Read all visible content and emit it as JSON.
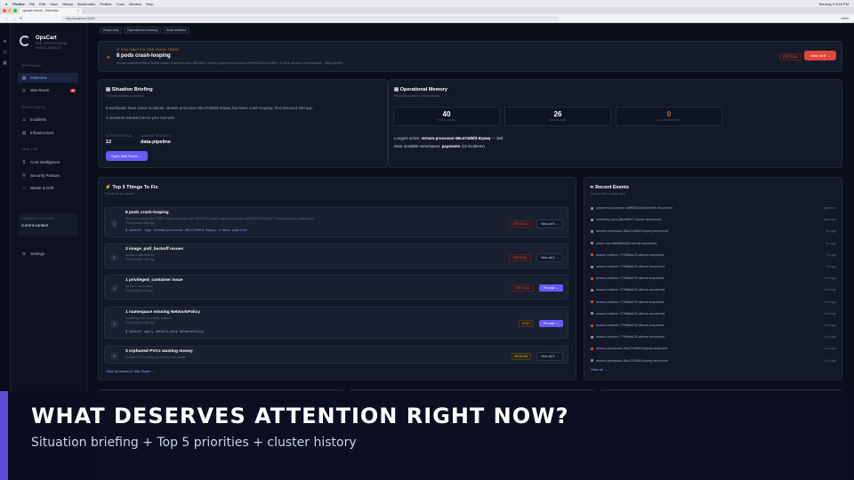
{
  "mac_menu": {
    "items": [
      "Firefox",
      "File",
      "Edit",
      "View",
      "History",
      "Bookmarks",
      "Profiles",
      "Tools",
      "Window",
      "Help"
    ],
    "clock": "Sat Aug 9 9:49 PM"
  },
  "browser": {
    "tab_title": "opscart review - Overview",
    "url": "http://localhost:3000/",
    "zoom": "100%"
  },
  "brand": {
    "name": "OpsCart",
    "sub": "K8S OPERATIONAL INTELLIGENCE"
  },
  "nav": {
    "sections": {
      "overview": "OVERVIEW",
      "investigate": "INVESTIGATE",
      "analyze": "ANALYZE"
    },
    "items": [
      {
        "label": "Overview",
        "icon": "grid-icon"
      },
      {
        "label": "War Room",
        "icon": "target-icon",
        "badge": "9"
      },
      {
        "label": "Incidents",
        "icon": "alert-icon"
      },
      {
        "label": "Infrastructure",
        "icon": "server-icon"
      },
      {
        "label": "Cost Intelligence",
        "icon": "dollar-icon"
      },
      {
        "label": "Security Posture",
        "icon": "shield-icon"
      },
      {
        "label": "Waste & Drift",
        "icon": "trash-icon"
      },
      {
        "label": "Settings",
        "icon": "gear-icon"
      }
    ],
    "cluster_label": "CURRENT CLUSTER",
    "cluster_value": "current-context"
  },
  "pills": [
    "Read-only",
    "Operational memory",
    "Auth enabled"
  ],
  "alert": {
    "kicker": "IF YOU ONLY FIX ONE THING TODAY",
    "title": "8 pods crash-looping",
    "desc": "stream-processor-66c474d5fd-9zpwq, inventory-sync-86cb8547-mhwm, payment-processor-5df9584466-bmm5b + 5 more across 4 namespaces · data-pipeline",
    "tag": "CRITICAL",
    "button": "View all 8 →"
  },
  "briefing": {
    "title": "Situation Briefing",
    "sub": "Current situation summary",
    "p1": "8 workloads have active incidents. stream-processor-66c474d5fd-9zpwq has been crash-looping, first detected 28d ago.",
    "p2": "2 incidents resolved since your last visit.",
    "k1": "ACTIVE CRITICAL",
    "v1": "12",
    "k2": "HIGHEST PRIORITY",
    "v2": "data-pipeline",
    "button": "Open War Room →"
  },
  "memory": {
    "title": "Operational Memory",
    "sub": "What this cluster's history shows",
    "stats": [
      {
        "n": "40",
        "l": "TOTAL SEEN",
        "color": "#ffffff"
      },
      {
        "n": "26",
        "l": "RESOLVED",
        "color": "#ffffff"
      },
      {
        "n": "0",
        "l": "ACCELERATING",
        "color": "#e85a53"
      }
    ],
    "longest_label": "Longest active:",
    "longest_value": "stream-processor-66c474d5fd-9zpwq",
    "longest_age": "— 28d",
    "unstable_label": "Most unstable namespace:",
    "unstable_value": "payments",
    "unstable_count": "(13 incidents)"
  },
  "top5": {
    "title": "Top 5 Things To Fix",
    "sub": "Prioritized by impact",
    "rows": [
      {
        "n": "1",
        "title": "8 pods crash-looping",
        "meta": "stream-processor-66c474d5fd-9zpwq, inventory-sync-86cb8547-mhwm, payment-processor-5df9584466-bmm5b + 5 more across 4 namespaces",
        "meta2": "First detected 28d ago",
        "code": "$ kubectl logs stream-processor-66c474d5fd-9zpwq -n data-pipeline",
        "tag": "CRITICAL",
        "tagtype": "crit",
        "action": "View all 8 →",
        "fix": false
      },
      {
        "n": "2",
        "title": "3 image_pull_backoff issues",
        "meta": "Across 3 namespaces",
        "meta2": "First detected 28d ago",
        "code": "",
        "tag": "CRITICAL",
        "tagtype": "crit",
        "action": "View all 3 →",
        "fix": false
      },
      {
        "n": "3",
        "title": "1 privileged_container issue",
        "meta": "Across 1 namespace",
        "meta2": "First detected 5d ago",
        "code": "",
        "tag": "CRITICAL",
        "tagtype": "crit",
        "action": "Fix now →",
        "fix": true
      },
      {
        "n": "4",
        "title": "1 namespace missing NetworkPolicy",
        "meta": "monitoring has no network isolation",
        "meta2": "First detected 28d ago",
        "code": "$ kubectl apply default-deny NetworkPolicy",
        "tag": "HIGH",
        "tagtype": "high",
        "action": "Fix now →",
        "fix": true
      },
      {
        "n": "5",
        "title": "3 orphaned PVCs wasting money",
        "meta": "Unused PVCs costing you money each month",
        "meta2": "",
        "code": "",
        "tag": "MEDIUM",
        "tagtype": "med",
        "action": "View all 3 →",
        "fix": false
      }
    ],
    "footer_link": "View all issues in War Room →"
  },
  "events": {
    "title": "Recent Events",
    "sub": "Cluster-wide activity feed",
    "items": [
      {
        "text": "payment-processor-5df9584466-bmm5b recovered",
        "ago": "just now",
        "color": "#8894ad"
      },
      {
        "text": "inventory-sync-86cb8547-mhwm recovered",
        "ago": "just now",
        "color": "#8894ad"
      },
      {
        "text": "stream-processor-66c474d5fd-9zpwq recovered",
        "ago": "5s ago",
        "color": "#8894ad"
      },
      {
        "text": "crash-test-5fd5884b49-wdc48 recovered",
        "ago": "5s ago",
        "color": "#8894ad"
      },
      {
        "text": "search-indexer-7799fdbd78-dfwnm reopened",
        "ago": "7s ago",
        "color": "#e0463d"
      },
      {
        "text": "search-indexer-7799fdbd78-dfwnm recovered",
        "ago": "7s ago",
        "color": "#8894ad"
      },
      {
        "text": "search-indexer-7799fdbd78-dfwnm reopened",
        "ago": "10s ago",
        "color": "#e0463d"
      },
      {
        "text": "search-indexer-7799fdbd78-dfwnm recovered",
        "ago": "10s ago",
        "color": "#8894ad"
      },
      {
        "text": "search-indexer-7799fdbd78-dfwnm reopened",
        "ago": "10s ago",
        "color": "#e0463d"
      },
      {
        "text": "search-indexer-7799fdbd78-dfwnm recovered",
        "ago": "10s ago",
        "color": "#8894ad"
      },
      {
        "text": "search-indexer-7799fdbd78-dfwnm reopened",
        "ago": "10s ago",
        "color": "#e0463d"
      },
      {
        "text": "search-indexer-7799fdbd78-dfwnm recovered",
        "ago": "10s ago",
        "color": "#8894ad"
      },
      {
        "text": "stream-processor-66c474d5fd-9zpwq reopened",
        "ago": "11s ago",
        "color": "#e0463d"
      },
      {
        "text": "stream-processor-66c474d5fd-9zpwq recovered",
        "ago": "11s ago",
        "color": "#8894ad"
      }
    ],
    "view_all": "View all →"
  },
  "banner": {
    "heading": "WHAT DESERVES ATTENTION RIGHT NOW?",
    "sub": "Situation briefing + Top 5 priorities + cluster history"
  }
}
